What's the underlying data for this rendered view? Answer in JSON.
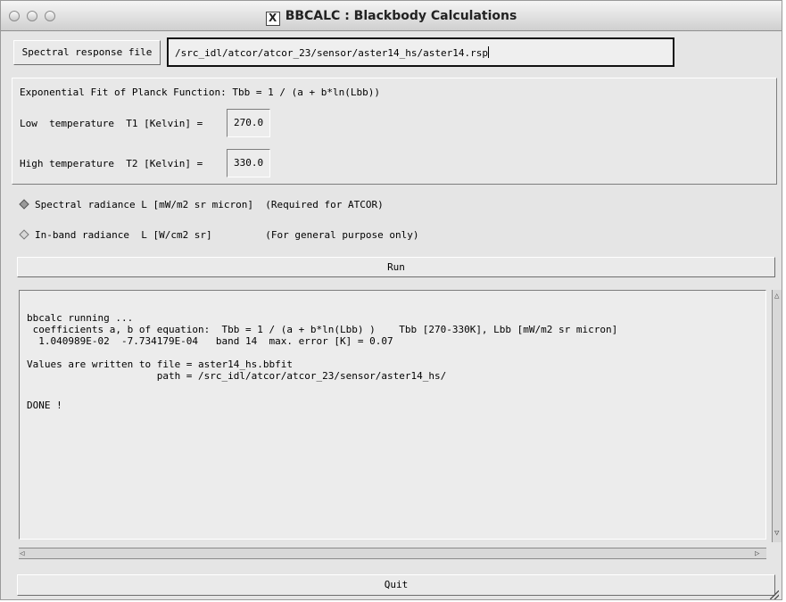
{
  "window": {
    "title": "BBCALC : Blackbody Calculations",
    "title_icon": "x11-icon"
  },
  "spectral": {
    "button_label": "Spectral response file",
    "file_path": "/src_idl/atcor/atcor_23/sensor/aster14_hs/aster14.rsp"
  },
  "fit": {
    "heading": "Exponential Fit of Planck Function: Tbb = 1 / (a + b*ln(Lbb))",
    "low_label": "Low  temperature  T1 [Kelvin] =",
    "low_value": "270.0",
    "high_label": "High temperature  T2 [Kelvin] =",
    "high_value": "330.0"
  },
  "radiance": {
    "option1_label": "Spectral radiance L [mW/m2 sr micron]  (Required for ATCOR)",
    "option2_label": "In-band radiance  L [W/cm2 sr]         (For general purpose only)",
    "selected": "Spectral radiance"
  },
  "run_label": "Run",
  "log": {
    "lines": [
      "bbcalc running ...",
      " coefficients a, b of equation:  Tbb = 1 / (a + b*ln(Lbb) )    Tbb [270-330K], Lbb [mW/m2 sr micron]",
      "  1.040989E-02  -7.734179E-04   band 14  max. error [K] = 0.07",
      "",
      "Values are written to file = aster14_hs.bbfit",
      "                      path = /src_idl/atcor/atcor_23/sensor/aster14_hs/",
      "",
      "DONE !"
    ]
  },
  "quit_label": "Quit"
}
